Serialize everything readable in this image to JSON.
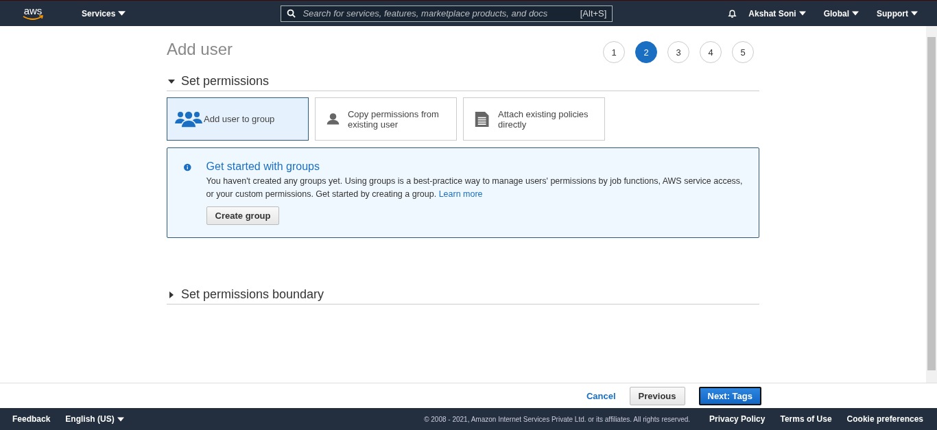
{
  "nav": {
    "logo": "aws",
    "services": "Services",
    "search": {
      "placeholder": "Search for services, features, marketplace products, and docs",
      "shortcut": "[Alt+S]"
    },
    "menus": [
      "Akshat Soni",
      "Global",
      "Support"
    ]
  },
  "page": {
    "title": "Add user",
    "steps": [
      {
        "label": "1",
        "selected": false
      },
      {
        "label": "2",
        "selected": true
      },
      {
        "label": "3",
        "selected": false
      },
      {
        "label": "4",
        "selected": false
      },
      {
        "label": "5",
        "selected": false
      }
    ]
  },
  "sections": [
    {
      "title": "Set permissions",
      "expanded": true
    },
    {
      "title": "Set permissions boundary",
      "expanded": false
    }
  ],
  "options": [
    {
      "kind": "group",
      "label": "Add user to group",
      "selected": true
    },
    {
      "kind": "user",
      "label": "Copy permissions from existing user",
      "selected": false
    },
    {
      "kind": "document",
      "label": "Attach existing policies directly",
      "selected": false
    }
  ],
  "info": {
    "title": "Get started with groups",
    "text": "You haven't created any groups yet. Using groups is a best-practice way to manage users' permissions by job functions, AWS service access, or your custom permissions. Get started by creating a group.",
    "link": "Learn more",
    "button": "Create group"
  },
  "actions": {
    "cancel": "Cancel",
    "previous": "Previous",
    "next": "Next: Tags"
  },
  "footer": {
    "left": [
      "Feedback",
      "English (US)"
    ],
    "copyright": "© 2008 - 2021, Amazon Internet Services Private Ltd. or its affiliates. All rights reserved.",
    "links": [
      "Privacy Policy",
      "Terms of Use",
      "Cookie preferences"
    ]
  }
}
